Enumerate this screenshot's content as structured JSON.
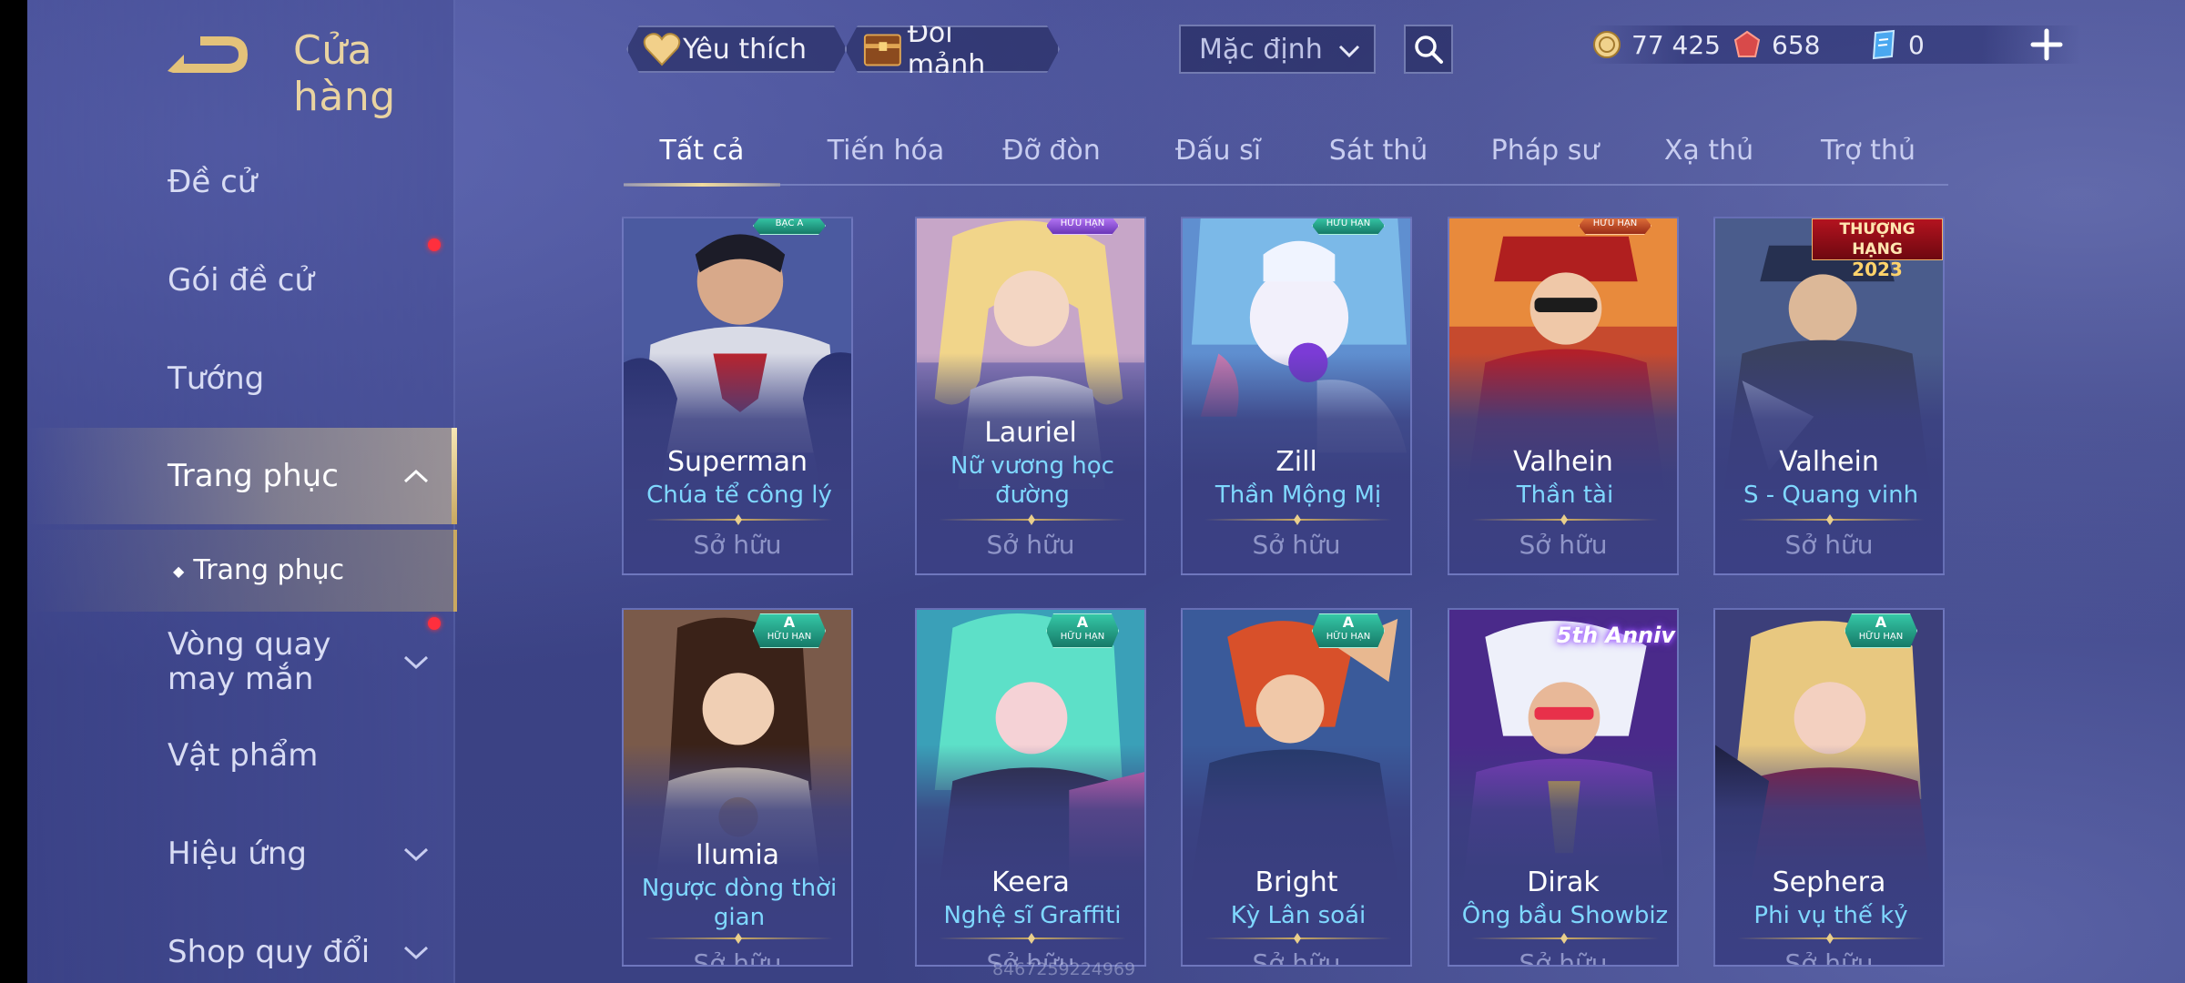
{
  "header": {
    "title": "Cửa hàng",
    "favorites_label": "Yêu thích",
    "exchange_label": "Đổi mảnh",
    "sort_value": "Mặc định",
    "currencies": {
      "gold": "77 425",
      "ruby": "658",
      "voucher": "0"
    }
  },
  "sidebar": {
    "items": [
      {
        "label": "Đề cử"
      },
      {
        "label": "Gói đề cử"
      },
      {
        "label": "Tướng"
      },
      {
        "label": "Trang phục"
      },
      {
        "label": "Trang phục"
      },
      {
        "label": "Vòng quay may mắn"
      },
      {
        "label": "Vật phẩm"
      },
      {
        "label": "Hiệu ứng"
      },
      {
        "label": "Shop quy đổi"
      }
    ]
  },
  "tabs": [
    "Tất cả",
    "Tiến hóa",
    "Đỡ đòn",
    "Đấu sĩ",
    "Sát thủ",
    "Pháp sư",
    "Xạ thủ",
    "Trợ thủ"
  ],
  "cards": [
    {
      "hero": "Superman",
      "skin": "Chúa tể công lý",
      "status": "Sở hữu",
      "badge": "BẠC A"
    },
    {
      "hero": "Lauriel",
      "skin": "Nữ vương học đường",
      "status": "Sở hữu",
      "badge": "HỮU HẠN"
    },
    {
      "hero": "Zill",
      "skin": "Thần Mộng Mị",
      "status": "Sở hữu",
      "badge": "HỮU HẠN"
    },
    {
      "hero": "Valhein",
      "skin": "Thần tài",
      "status": "Sở hữu",
      "badge": "HỮU HẠN"
    },
    {
      "hero": "Valhein",
      "skin": "S - Quang vinh",
      "status": "Sở hữu",
      "badge_line1": "THƯỢNG HẠNG",
      "badge_line2": "2023"
    },
    {
      "hero": "Ilumia",
      "skin": "Ngược dòng thời gian",
      "status": "Sở hữu",
      "badge_grade": "A",
      "badge": "HỮU HẠN"
    },
    {
      "hero": "Keera",
      "skin": "Nghệ sĩ Graffiti",
      "status": "Sở hữu",
      "badge_grade": "A",
      "badge": "HỮU HẠN"
    },
    {
      "hero": "Bright",
      "skin": "Kỳ Lân soái",
      "status": "Sở hữu",
      "badge_grade": "A",
      "badge": "HỮU HẠN"
    },
    {
      "hero": "Dirak",
      "skin": "Ông bầu Showbiz",
      "status": "Sở hữu",
      "badge": "5th Anniv"
    },
    {
      "hero": "Sephera",
      "skin": "Phi vụ thế kỷ",
      "status": "Sở hữu",
      "badge_grade": "A",
      "badge": "HỮU HẠN"
    }
  ],
  "watermark": "8467259224969",
  "colors": {
    "accent_gold": "#e9d3a1",
    "skin_name": "#7fd8ff",
    "background": "#3c4386",
    "notification": "#ff2f3d"
  }
}
